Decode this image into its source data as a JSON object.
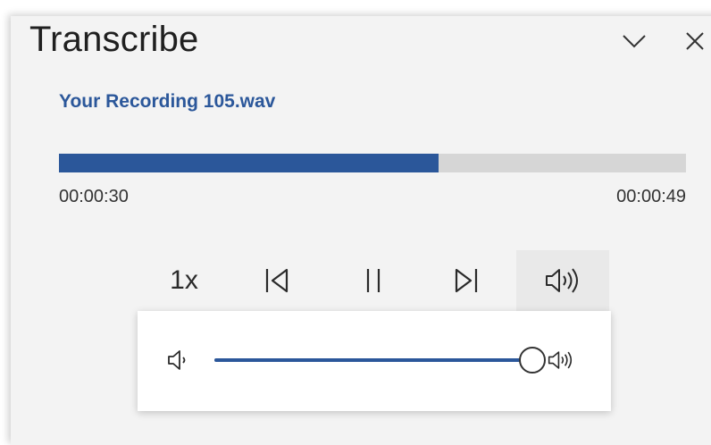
{
  "panel": {
    "title": "Transcribe",
    "collapse_icon": "chevron-down-icon",
    "close_icon": "close-icon"
  },
  "recording": {
    "filename": "Your Recording 105.wav",
    "current_time": "00:00:30",
    "total_time": "00:00:49",
    "progress": 0.606
  },
  "controls": {
    "speed_label": "1x",
    "previous_icon": "skip-back-icon",
    "pause_icon": "pause-icon",
    "next_icon": "skip-forward-icon",
    "volume_icon": "volume-icon"
  },
  "volume_flyout": {
    "level": 1.0,
    "low_icon": "volume-low-icon",
    "high_icon": "volume-high-icon"
  },
  "colors": {
    "accent": "#2b579a",
    "track": "#d6d6d6",
    "panel_bg": "#f3f3f3"
  }
}
